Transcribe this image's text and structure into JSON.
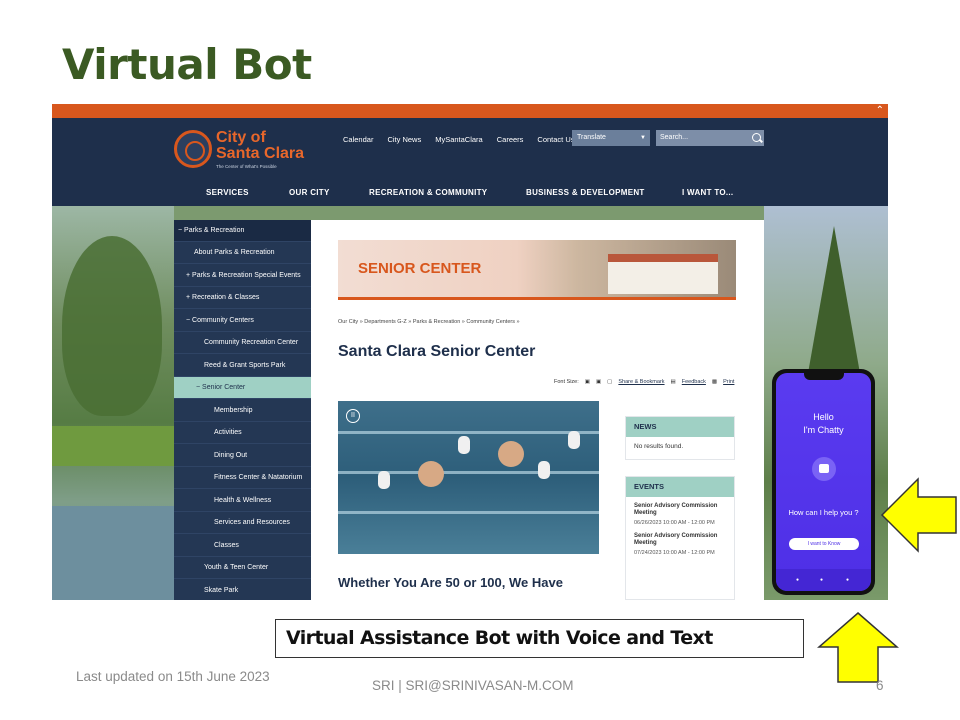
{
  "slide": {
    "title": "Virtual Bot",
    "caption": "Virtual Assistance Bot with Voice and Text",
    "footer_updated": "Last updated on 15th June 2023",
    "footer_author": "SRI | SRI@SRINIVASAN-M.COM",
    "page_number": "6",
    "arrow_color": "#ffff00"
  },
  "site": {
    "logo_line1": "City of",
    "logo_line2": "Santa Clara",
    "logo_tagline": "The Center of What's Possible",
    "top_links": [
      "Calendar",
      "City News",
      "MySantaClara",
      "Careers",
      "Contact Us"
    ],
    "translate_label": "Translate",
    "search_placeholder": "Search...",
    "main_nav": [
      "SERVICES",
      "OUR CITY",
      "RECREATION & COMMUNITY",
      "BUSINESS & DEVELOPMENT",
      "I WANT TO..."
    ],
    "sidebar": [
      "Parks & Recreation",
      "About Parks & Recreation",
      "Parks & Recreation Special Events",
      "Recreation & Classes",
      "Community Centers",
      "Community Recreation Center",
      "Reed & Grant Sports Park",
      "Senior Center",
      "Membership",
      "Activities",
      "Dining Out",
      "Fitness Center & Natatorium",
      "Health & Wellness",
      "Services and Resources",
      "Classes",
      "Youth & Teen Center",
      "Skate Park"
    ],
    "sidebar_prefix": [
      "−",
      "",
      "+",
      "+",
      "−",
      "",
      "",
      "−",
      "",
      "",
      "",
      "",
      "",
      "",
      "",
      "",
      ""
    ],
    "banner_title": "SENIOR CENTER",
    "breadcrumb": "Our City » Departments G-Z » Parks & Recreation » Community Centers »",
    "page_title": "Santa Clara Senior Center",
    "font_size_label": "Font Size:",
    "share_label": "Share & Bookmark",
    "feedback_label": "Feedback",
    "print_label": "Print",
    "news_heading": "NEWS",
    "news_empty": "No results found.",
    "events_heading": "EVENTS",
    "events": [
      {
        "title": "Senior Advisory Commission Meeting",
        "date": "06/26/2023 10:00 AM - 12:00 PM"
      },
      {
        "title": "Senior Advisory Commission Meeting",
        "date": "07/24/2023 10:00 AM - 12:00 PM"
      }
    ],
    "headline": "Whether You Are 50 or 100, We Have"
  },
  "bot": {
    "greeting_1": "Hello",
    "greeting_2": "I'm Chatty",
    "prompt": "How can I help you ?",
    "button": "I want to Know",
    "accent": "#5a3bf0"
  }
}
